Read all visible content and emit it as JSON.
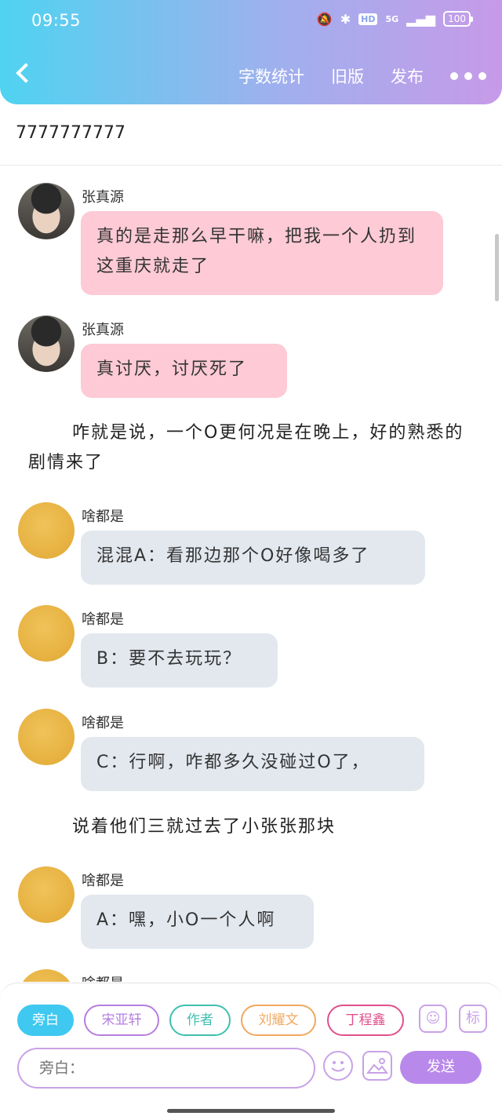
{
  "status_bar": {
    "time": "09:55",
    "hd": "HD",
    "network": "5G",
    "battery": "100"
  },
  "nav": {
    "word_count": "字数统计",
    "old_version": "旧版",
    "publish": "发布"
  },
  "title": "7777777777",
  "messages": [
    {
      "sender": "张真源",
      "text": "真的是走那么早干嘛，把我一个人扔到这重庆就走了"
    },
    {
      "sender": "张真源",
      "text": "真讨厌，讨厌死了"
    },
    {
      "narration": "咋就是说，一个O更何况是在晚上，好的熟悉的剧情来了"
    },
    {
      "sender": "啥都是",
      "text": "混混A：看那边那个O好像喝多了"
    },
    {
      "sender": "啥都是",
      "text": "B：要不去玩玩？"
    },
    {
      "sender": "啥都是",
      "text": "C：行啊，咋都多久没碰过O了，"
    },
    {
      "narration": "说着他们三就过去了小张张那块"
    },
    {
      "sender": "啥都是",
      "text": "A：嘿，小O一个人啊"
    },
    {
      "sender": "啥都是"
    }
  ],
  "roles": [
    "旁白",
    "宋亚轩",
    "作者",
    "刘耀文",
    "丁程鑫"
  ],
  "role_colors": [
    "#3fc8f0",
    "#b47ee0",
    "#3fbfb0",
    "#f0a860",
    "#e0508c"
  ],
  "tag_icon": "标",
  "input": {
    "placeholder": "旁白："
  },
  "send_label": "发送"
}
